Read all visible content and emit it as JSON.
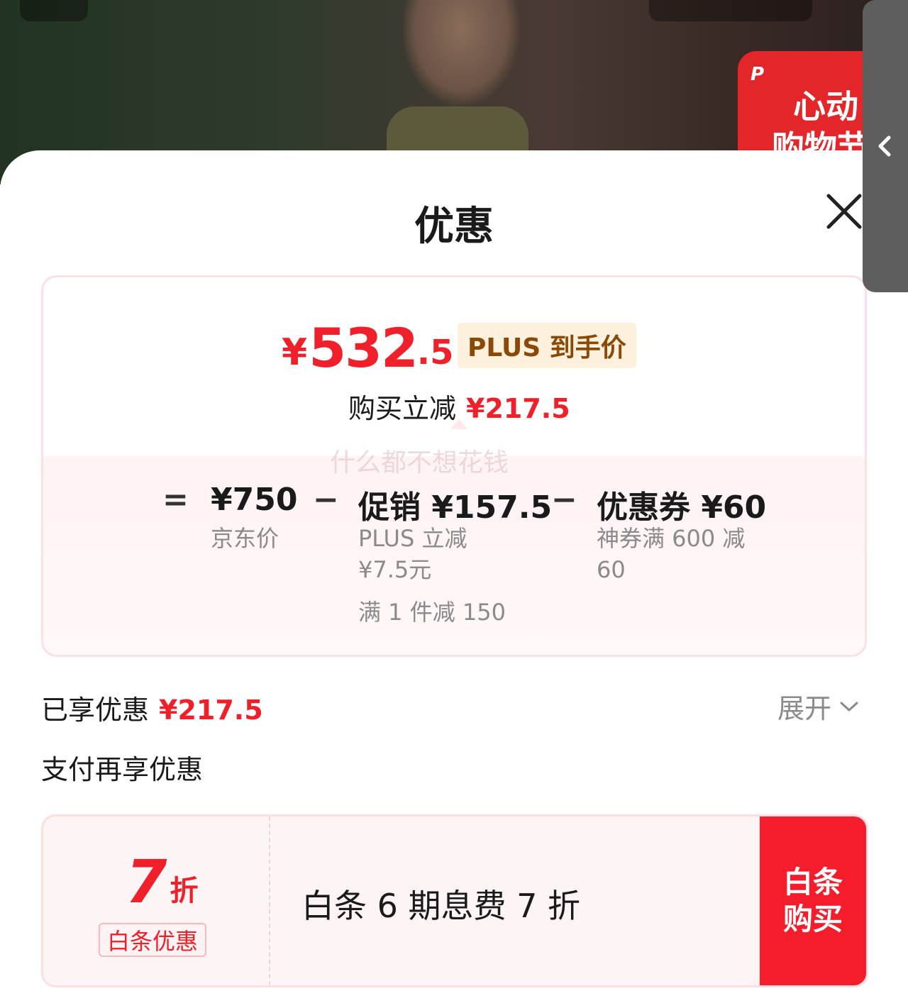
{
  "background": {
    "promo_tag_line1": "P",
    "promo_tag_line2": "心动",
    "promo_tag_line3": "购物节"
  },
  "sheet": {
    "title": "优惠",
    "close_icon": "close-icon"
  },
  "price": {
    "yen": "¥",
    "integer": "532",
    "decimal": ".5",
    "badge": "PLUS 到手价",
    "save_label": "购买立减",
    "save_value": "¥217.5",
    "watermark": "什么都不想花钱"
  },
  "breakdown": {
    "eq": "=",
    "minus": "−",
    "base_value": "¥750",
    "base_label": "京东价",
    "promo_value": "促销 ¥157.5",
    "promo_sub1": "PLUS 立减",
    "promo_sub2": "¥7.5元",
    "promo_sub3": "满 1 件减 150",
    "coupon_value": "优惠券 ¥60",
    "coupon_sub1": "神券满 600 减",
    "coupon_sub2": "60"
  },
  "enjoyed": {
    "label": "已享优惠",
    "value": "¥217.5",
    "expand_label": "展开"
  },
  "pay": {
    "section_title": "支付再享优惠",
    "discount_number": "7",
    "discount_unit": "折",
    "tag": "白条优惠",
    "description": "白条 6 期息费 7 折",
    "button_line1": "白条",
    "button_line2": "购买"
  },
  "colors": {
    "accent_red": "#f0202a",
    "plus_gold": "#8a4a06"
  }
}
